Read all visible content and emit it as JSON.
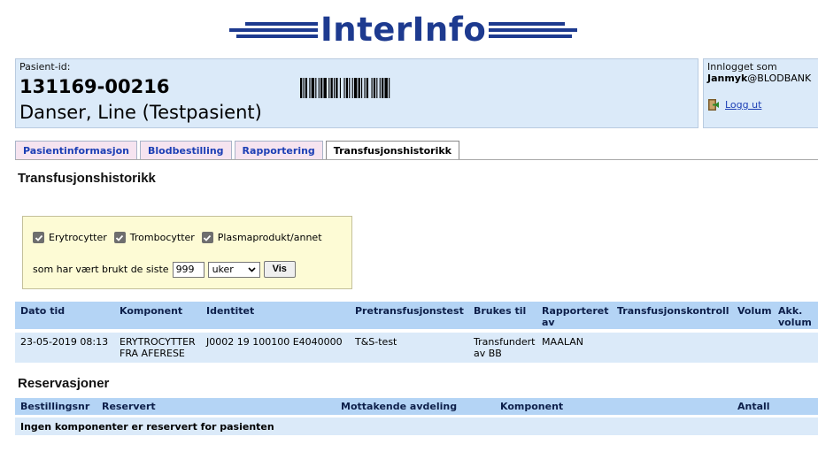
{
  "logo": {
    "text": "InterInfo"
  },
  "patient": {
    "id_label": "Pasient-id:",
    "id": "131169-00216",
    "name": "Danser, Line (Testpasient)"
  },
  "login": {
    "label": "Innlogget som",
    "user": "Janmyk",
    "domain": "@BLODBANK",
    "logout": "Logg ut"
  },
  "tabs": [
    {
      "label": "Pasientinformasjon",
      "active": false
    },
    {
      "label": "Blodbestilling",
      "active": false
    },
    {
      "label": "Rapportering",
      "active": false
    },
    {
      "label": "Transfusjonshistorikk",
      "active": true
    }
  ],
  "page_title": "Transfusjonshistorikk",
  "filter": {
    "checkboxes": [
      {
        "label": "Erytrocytter",
        "checked": true
      },
      {
        "label": "Trombocytter",
        "checked": true
      },
      {
        "label": "Plasmaprodukt/annet",
        "checked": true
      }
    ],
    "period_label": "som har vært brukt de siste",
    "period_value": "999",
    "unit": "uker",
    "button": "Vis"
  },
  "history": {
    "headers": [
      "Dato tid",
      "Komponent",
      "Identitet",
      "Pretransfusjonstest",
      "Brukes til",
      "Rapporteret av",
      "Transfusjonskontroll",
      "Volum",
      "Akk. volum"
    ],
    "rows": [
      {
        "date": "23-05-2019 08:13",
        "component": "ERYTROCYTTER FRA AFERESE",
        "identity": "J0002 19 100100 E4040000",
        "pretest": "T&S-test",
        "used_for": "Transfundert av BB",
        "reported_by": "MAALAN",
        "control": "",
        "volume": "",
        "acc_volume": ""
      }
    ]
  },
  "reservations": {
    "title": "Reservasjoner",
    "headers": [
      "Bestillingsnr",
      "Reservert",
      "Mottakende avdeling",
      "Komponent",
      "Antall"
    ],
    "empty": "Ingen komponenter er reservert for pasienten"
  },
  "colors": {
    "accent": "#1d3a8f",
    "header_bg": "#dbeaf9",
    "table_header": "#b4d4f5",
    "filter_bg": "#fdfbd5",
    "tab_bg": "#f6e4f0",
    "link": "#1c3fb5"
  }
}
